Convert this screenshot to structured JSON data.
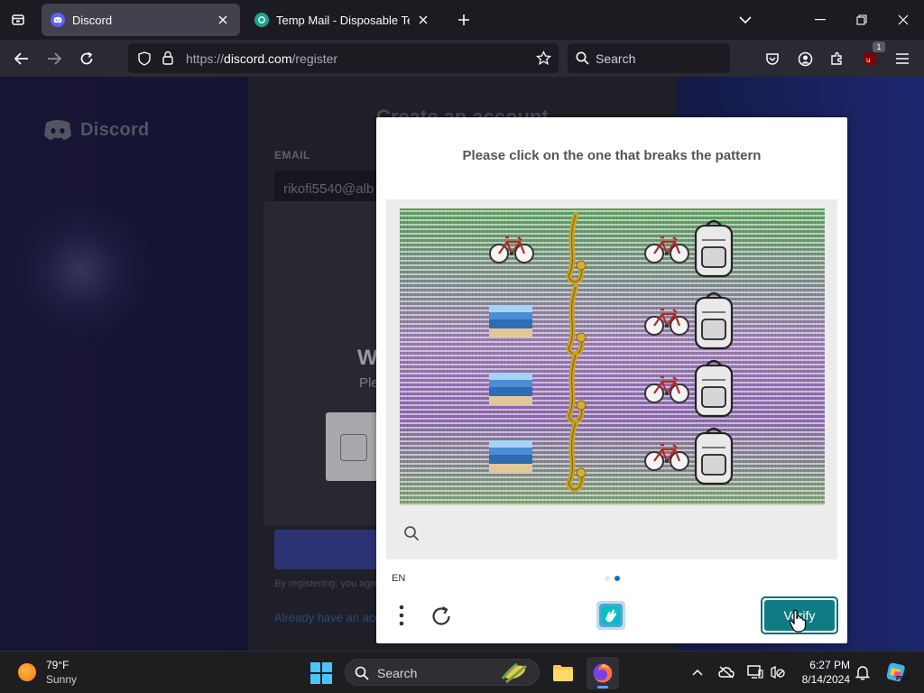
{
  "browser": {
    "tabs": [
      {
        "title": "Discord",
        "active": true
      },
      {
        "title": "Temp Mail - Disposable Temporary",
        "active": false
      }
    ],
    "url": {
      "scheme": "https://",
      "host": "discord.com",
      "path": "/register"
    },
    "search_placeholder": "Search",
    "extension_badge": "1"
  },
  "discord": {
    "logo_text": "Discord",
    "title": "Create an account",
    "email_label": "EMAIL",
    "email_value": "rikofi5540@alb",
    "legal_text": "By registering, you agree to Discord's",
    "login_link": "Already have an account?",
    "captcha_heading_partial": "W",
    "captcha_sub_partial": "Ple"
  },
  "challenge": {
    "prompt": "Please click on the one that breaks the pattern",
    "language": "EN",
    "verify_label": "Verify",
    "colors": {
      "accent": "#0f7c83",
      "dot_active": "#0a74c4",
      "dot_inactive": "#e6e6e6"
    },
    "grid": {
      "columns": 4,
      "rows": [
        [
          "bicycle-icon",
          "saxophone-icon",
          "bicycle-icon",
          "backpack-icon"
        ],
        [
          "beach-photo-icon",
          "saxophone-icon",
          "bicycle-icon",
          "backpack-icon"
        ],
        [
          "beach-photo-icon",
          "saxophone-icon",
          "bicycle-icon",
          "backpack-icon"
        ],
        [
          "beach-photo-icon",
          "saxophone-icon",
          "bicycle-icon",
          "backpack-icon"
        ]
      ]
    }
  },
  "taskbar": {
    "weather_temp": "79°F",
    "weather_desc": "Sunny",
    "search_placeholder": "Search",
    "time": "6:27 PM",
    "date": "8/14/2024"
  }
}
